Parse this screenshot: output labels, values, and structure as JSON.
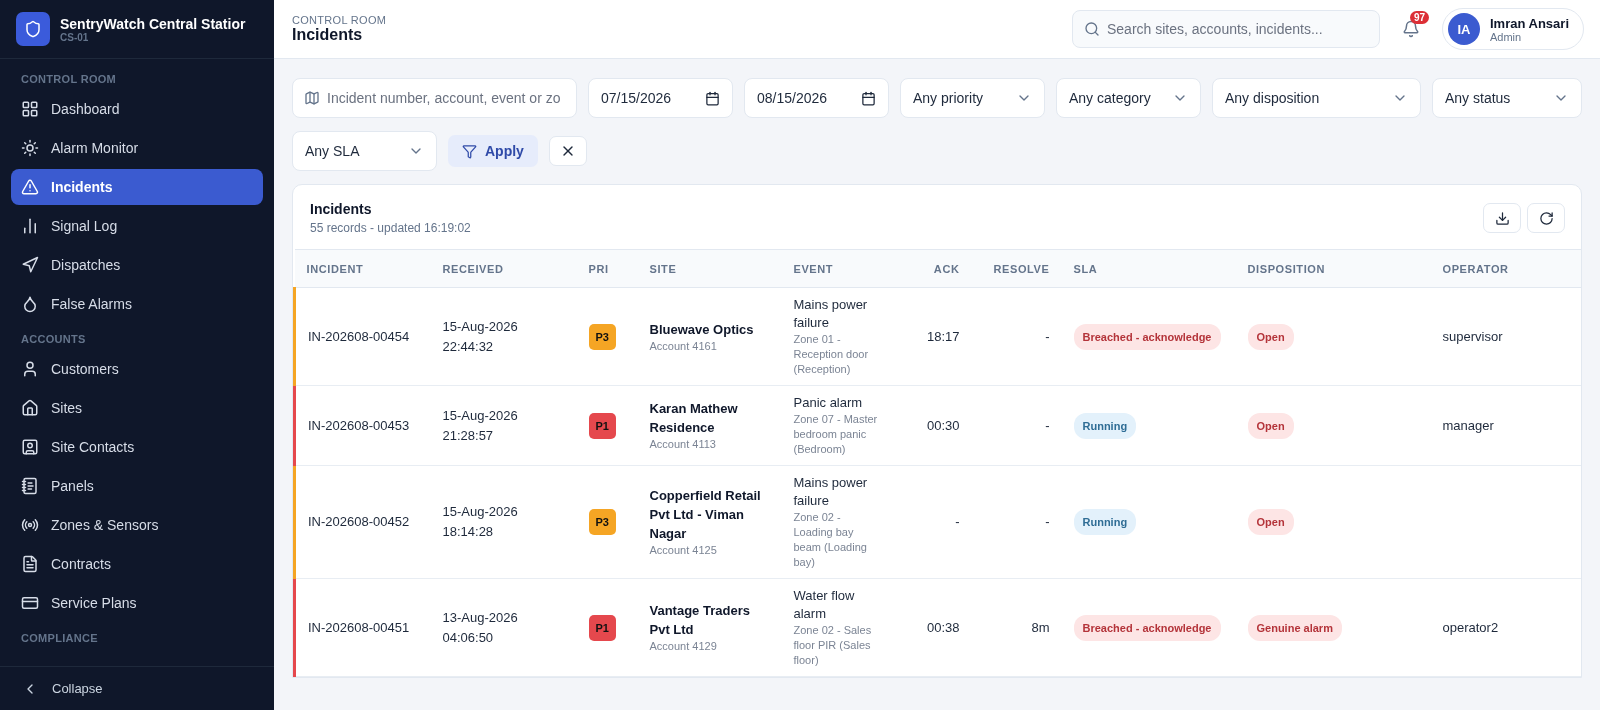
{
  "brand": {
    "name": "SentryWatch Central Statior",
    "code": "CS-01"
  },
  "sidebar": {
    "sections": [
      {
        "heading": "CONTROL ROOM",
        "items": [
          {
            "label": "Dashboard",
            "selected": false
          },
          {
            "label": "Alarm Monitor",
            "selected": false
          },
          {
            "label": "Incidents",
            "selected": true
          },
          {
            "label": "Signal Log",
            "selected": false
          },
          {
            "label": "Dispatches",
            "selected": false
          },
          {
            "label": "False Alarms",
            "selected": false
          }
        ]
      },
      {
        "heading": "ACCOUNTS",
        "items": [
          {
            "label": "Customers",
            "selected": false
          },
          {
            "label": "Sites",
            "selected": false
          },
          {
            "label": "Site Contacts",
            "selected": false
          },
          {
            "label": "Panels",
            "selected": false
          },
          {
            "label": "Zones & Sensors",
            "selected": false
          },
          {
            "label": "Contracts",
            "selected": false
          },
          {
            "label": "Service Plans",
            "selected": false
          }
        ]
      },
      {
        "heading": "COMPLIANCE"
      }
    ],
    "collapse": "Collapse"
  },
  "header": {
    "breadcrumb": "CONTROL ROOM",
    "title": "Incidents",
    "search_placeholder": "Search sites, accounts, incidents...",
    "notifications": "97",
    "user": {
      "initials": "IA",
      "name": "Imran Ansari",
      "role": "Admin"
    }
  },
  "filters": {
    "query_placeholder": "Incident number, account, event or zo",
    "date_from": "07/15/2026",
    "date_to": "08/15/2026",
    "selects": [
      "Any priority",
      "Any category",
      "Any disposition",
      "Any status",
      "Any SLA"
    ],
    "apply": "Apply"
  },
  "table": {
    "title": "Incidents",
    "subtitle": "55 records - updated 16:19:02",
    "columns": [
      "INCIDENT",
      "RECEIVED",
      "PRI",
      "SITE",
      "EVENT",
      "ACK",
      "RESOLVE",
      "SLA",
      "DISPOSITION",
      "OPERATOR"
    ],
    "rows": [
      {
        "incident": "IN-202608-00454",
        "date": "15-Aug-2026",
        "time": "22:44:32",
        "priority": "P3",
        "color": "#f5a524",
        "site": "Bluewave Optics",
        "account": "Account 4161",
        "event": "Mains power failure",
        "zone": "Zone 01 - Reception door (Reception)",
        "ack": "18:17",
        "resolve": "-",
        "sla": {
          "label": "Breached - acknowledge",
          "kind": "breached"
        },
        "disposition": "Open",
        "operator": "supervisor"
      },
      {
        "incident": "IN-202608-00453",
        "date": "15-Aug-2026",
        "time": "21:28:57",
        "priority": "P1",
        "color": "#e5484d",
        "site": "Karan Mathew Residence",
        "account": "Account 4113",
        "event": "Panic alarm",
        "zone": "Zone 07 - Master bedroom panic (Bedroom)",
        "ack": "00:30",
        "resolve": "-",
        "sla": {
          "label": "Running",
          "kind": "running"
        },
        "disposition": "Open",
        "operator": "manager"
      },
      {
        "incident": "IN-202608-00452",
        "date": "15-Aug-2026",
        "time": "18:14:28",
        "priority": "P3",
        "color": "#f5a524",
        "site": "Copperfield Retail Pvt Ltd - Viman Nagar",
        "account": "Account 4125",
        "event": "Mains power failure",
        "zone": "Zone 02 - Loading bay beam (Loading bay)",
        "ack": "-",
        "resolve": "-",
        "sla": {
          "label": "Running",
          "kind": "running"
        },
        "disposition": "Open"
      },
      {
        "incident": "IN-202608-00451",
        "date": "13-Aug-2026",
        "time": "04:06:50",
        "priority": "P1",
        "color": "#e5484d",
        "site": "Vantage Traders Pvt Ltd",
        "account": "Account 4129",
        "event": "Water flow alarm",
        "zone": "Zone 02 - Sales floor PIR (Sales floor)",
        "ack": "00:38",
        "resolve": "8m",
        "sla": {
          "label": "Breached - acknowledge",
          "kind": "breached"
        },
        "disposition": "Genuine alarm",
        "operator": "operator2"
      }
    ]
  }
}
